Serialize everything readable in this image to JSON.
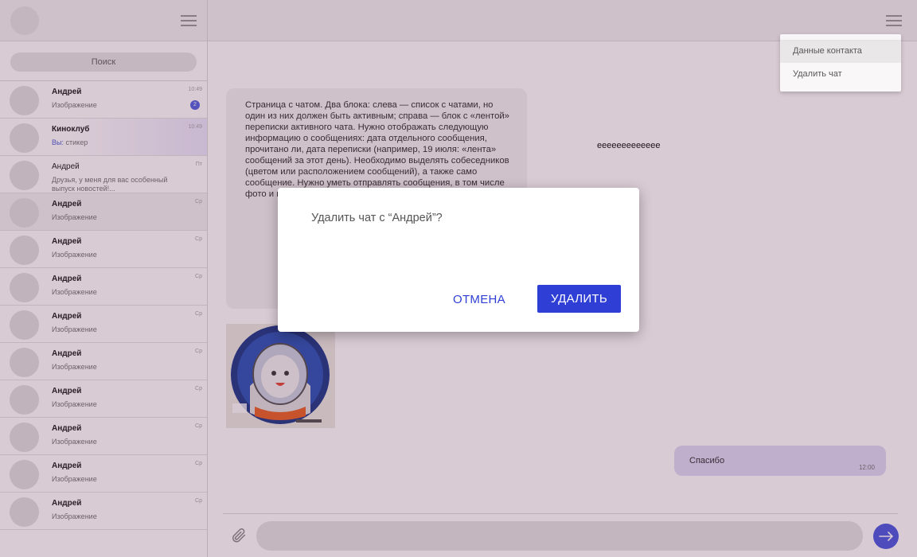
{
  "sidebar": {
    "search_placeholder": "Поиск",
    "chats": [
      {
        "name": "Андрей",
        "preview": "Изображение",
        "time": "10:49",
        "unread": "2",
        "bold": true
      },
      {
        "name": "Киноклуб",
        "you": "Вы:",
        "preview": "стикер",
        "time": "10:49",
        "highlight": true
      },
      {
        "name": "Андрей",
        "preview": "Друзья, у меня для вас особенный выпуск новостей!...",
        "time": "Пт",
        "regular": true
      },
      {
        "name": "Андрей",
        "preview": "Изображение",
        "time": "Ср",
        "active": true
      },
      {
        "name": "Андрей",
        "preview": "Изображение",
        "time": "Ср"
      },
      {
        "name": "Андрей",
        "preview": "Изображение",
        "time": "Ср"
      },
      {
        "name": "Андрей",
        "preview": "Изображение",
        "time": "Ср"
      },
      {
        "name": "Андрей",
        "preview": "Изображение",
        "time": "Ср"
      },
      {
        "name": "Андрей",
        "preview": "Изображение",
        "time": "Ср"
      },
      {
        "name": "Андрей",
        "preview": "Изображение",
        "time": "Ср"
      },
      {
        "name": "Андрей",
        "preview": "Изображение",
        "time": "Ср"
      },
      {
        "name": "Андрей",
        "preview": "Изображение",
        "time": "Ср"
      }
    ]
  },
  "context_menu": {
    "items": [
      "Данные контакта",
      "Удалить чат"
    ]
  },
  "conversation": {
    "incoming_text": "Страница с чатом. Два блока: слева — список с чатами, но один из них должен быть активным; справа — блок с «лентой» переписки активного чата. Нужно отображать следующую информацию о сообщениях: дата отдельного сообщения, прочитано ли, дата переписки (например, 19 июля: «лента» сообщений за этот день). Необходимо выделять собеседников (цветом или расположением сообщений), а также само сообщение. Нужно уметь отправлять сообщения, в том числе фото и видео.",
    "echo_text": "eeeeeeeeeeeee",
    "outgoing_text": "Спасибо",
    "outgoing_time": "12:00"
  },
  "modal": {
    "question": "Удалить чат с “Андрей”?",
    "cancel_label": "ОТМЕНА",
    "delete_label": "УДАЛИТЬ"
  },
  "colors": {
    "accent": "#2f3fd6",
    "unread_badge": "#5566e0",
    "outgoing_bubble": "#dedcf5",
    "overlay": "#50143c"
  },
  "icons": {
    "attach": "paperclip-icon",
    "send": "arrow-right-icon",
    "menu": "hamburger-icon"
  }
}
